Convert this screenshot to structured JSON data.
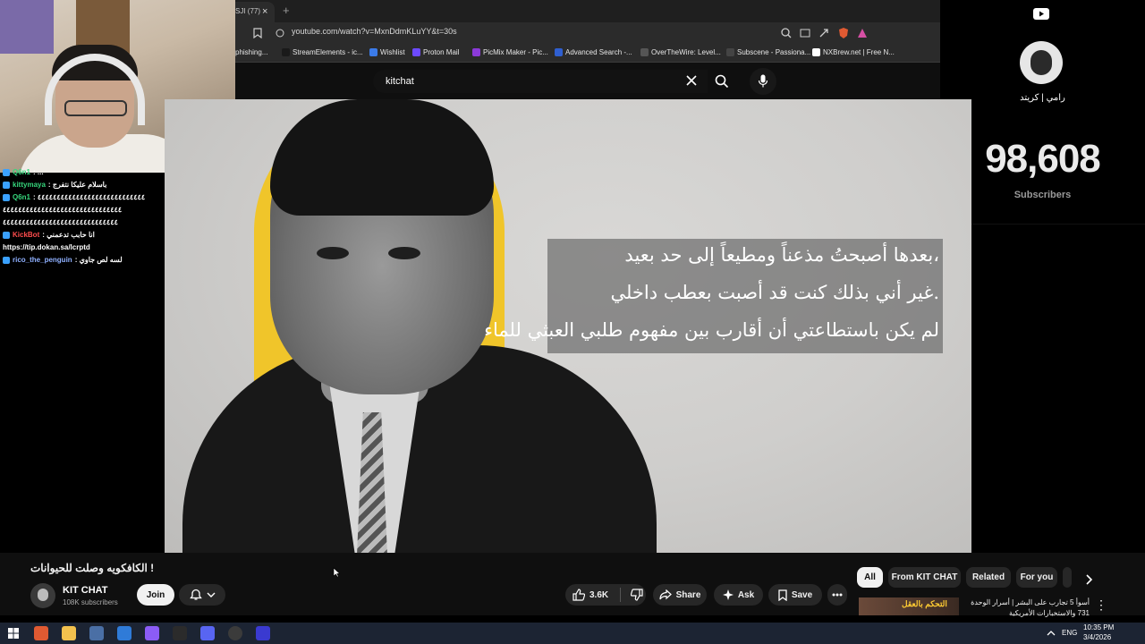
{
  "browser": {
    "tab_label": "SJI (77)",
    "url": "youtube.com/watch?v=MxnDdmKLuYY&t=30s",
    "bookmarks": [
      "phishing...",
      "StreamElements - ic...",
      "Wishlist",
      "Proton Mail",
      "PicMix Maker - Pic...",
      "Advanced Search -...",
      "OverTheWire: Level...",
      "Subscene - Passiona...",
      "NXBrew.net | Free N..."
    ]
  },
  "youtube": {
    "search_value": "kitchat"
  },
  "chat": [
    {
      "user": "Q6n1",
      "msg": ": ...",
      "color": "green"
    },
    {
      "user": "kittymaya",
      "msg": ": باسلام عليكا نتفرج",
      "color": "green"
    },
    {
      "user": "Q6n1",
      "msg": ": ٤٤٤٤٤٤٤٤٤٤٤٤٤٤٤٤٤٤٤٤٤٤٤٤٤٤٤٤",
      "color": "green"
    },
    {
      "user": "",
      "msg": "٤٤٤٤٤٤٤٤٤٤٤٤٤٤٤٤٤٤٤٤٤٤٤٤٤٤٤٤٤٤٤",
      "color": "green"
    },
    {
      "user": "",
      "msg": "٤٤٤٤٤٤٤٤٤٤٤٤٤٤٤٤٤٤٤٤٤٤٤٤٤٤٤٤٤٤",
      "color": "green"
    },
    {
      "user": "KickBot",
      "msg": ": انا حابب تدعمني",
      "color": "red"
    },
    {
      "user": "",
      "msg": "https://tip.dokan.sa/lcrptd",
      "color": "green"
    },
    {
      "user": "rico_the_penguin",
      "msg": ": لسه لص جاوي",
      "color": "blue"
    }
  ],
  "overlay": {
    "channel_name": "رامي | كريتد",
    "subscriber_count": "98,608",
    "subscriber_label": "Subscribers"
  },
  "video": {
    "quote_lines": [
      "،بعدها أصبحتُ مذعناً ومطيعاً إلى حد بعيد",
      ".غير أني بذلك كنت قد أصبت بعطب داخلي",
      "لم يكن باستطاعتي أن أقارب بين مفهوم طلبي العبثي للماء"
    ],
    "title": "الكافكويه وصلت للحيوانات !",
    "channel": "KIT CHAT",
    "subscribers": "108K subscribers",
    "join_label": "Join",
    "likes": "3.6K",
    "share_label": "Share",
    "ask_label": "Ask",
    "save_label": "Save"
  },
  "chips": [
    "All",
    "From KIT CHAT",
    "Related",
    "For you"
  ],
  "recommendation": {
    "thumb_text": "التحكم بالعقل",
    "title": "أسوأ 5 تجارب على البشر | أسرار الوحدة 731 والاستخبارات الأمريكية"
  },
  "taskbar": {
    "lang": "ENG",
    "time": "10:35 PM",
    "date": "3/4/2026"
  },
  "colors": {
    "accent_yellow": "#f0c52a",
    "youtube_bg": "#0f0f0f",
    "chat_green": "#36d67c"
  }
}
